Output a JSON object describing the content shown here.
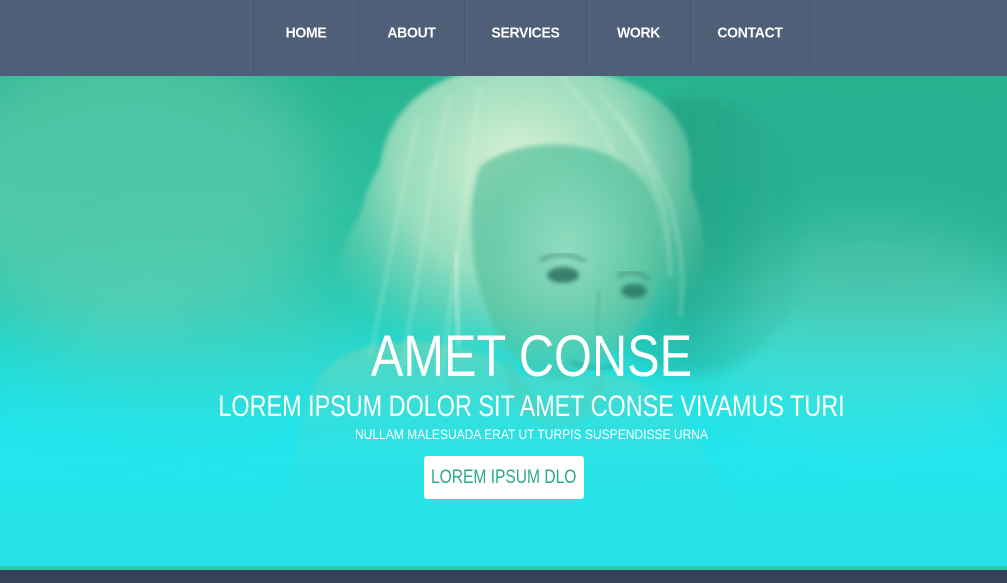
{
  "nav": {
    "items": [
      {
        "label": "HOME"
      },
      {
        "label": "ABOUT"
      },
      {
        "label": "SERVICES"
      },
      {
        "label": "WORK"
      },
      {
        "label": "CONTACT"
      }
    ]
  },
  "hero": {
    "title": "AMET CONSE",
    "subtitle": "LOREM IPSUM DOLOR SIT AMET CONSE VIVAMUS TURI",
    "tagline": "NULLAM MALESUADA ERAT UT TURPIS SUSPENDISSE URNA",
    "cta_label": "LOREM IPSUM DLO"
  },
  "colors": {
    "nav_bg": "#4f5f78",
    "hero_top": "#2ab591",
    "hero_bottom": "#22e6ef",
    "cta_text": "#2aa98a",
    "footer": "#36415a"
  }
}
